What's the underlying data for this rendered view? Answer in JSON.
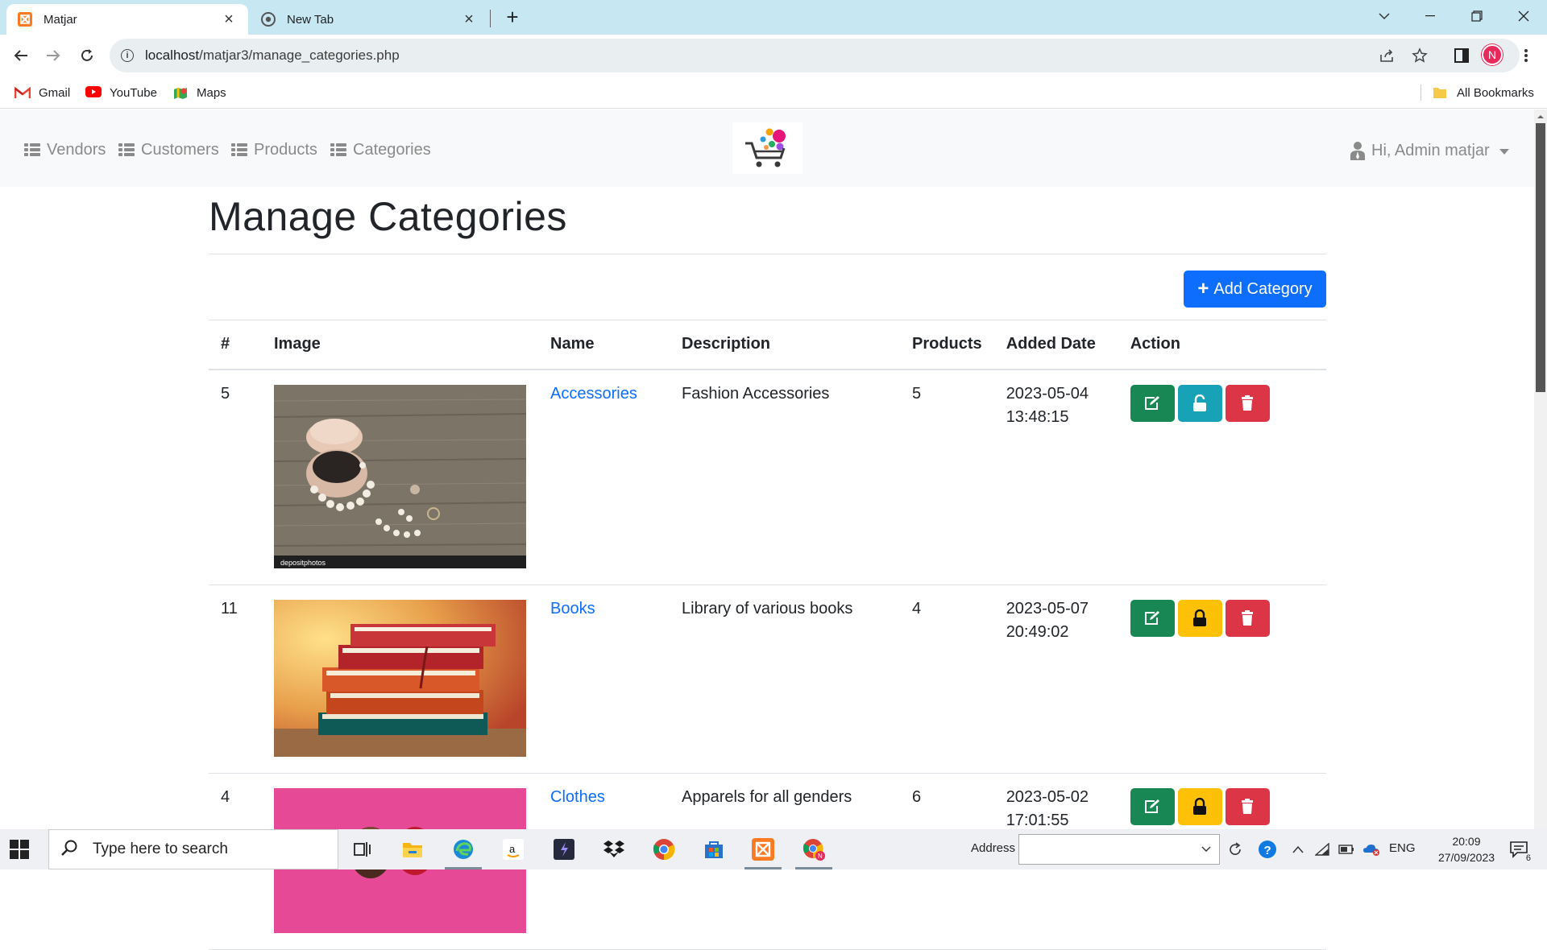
{
  "browser": {
    "tabs": [
      {
        "title": "Matjar",
        "active": true
      },
      {
        "title": "New Tab",
        "active": false
      }
    ],
    "url_host": "localhost",
    "url_path": "/matjar3/manage_categories.php",
    "profile_initial": "N",
    "bookmarks": [
      "Gmail",
      "YouTube",
      "Maps"
    ],
    "all_bookmarks": "All Bookmarks"
  },
  "nav": {
    "items": [
      "Vendors",
      "Customers",
      "Products",
      "Categories"
    ],
    "user": "Hi, Admin matjar"
  },
  "page": {
    "title": "Manage Categories",
    "add_button": "Add Category"
  },
  "table": {
    "headers": [
      "#",
      "Image",
      "Name",
      "Description",
      "Products",
      "Added Date",
      "Action"
    ],
    "rows": [
      {
        "id": "5",
        "name": "Accessories",
        "description": "Fashion Accessories",
        "products": "5",
        "date": "2023-05-04",
        "time": "13:48:15",
        "status": "unlocked"
      },
      {
        "id": "11",
        "name": "Books",
        "description": "Library of various books",
        "products": "4",
        "date": "2023-05-07",
        "time": "20:49:02",
        "status": "locked"
      },
      {
        "id": "4",
        "name": "Clothes",
        "description": "Apparels for all genders",
        "products": "6",
        "date": "2023-05-02",
        "time": "17:01:55",
        "status": "locked"
      }
    ],
    "image_watermark": "depositphotos"
  },
  "colors": {
    "primary": "#0d6efd",
    "success": "#198754",
    "info": "#17a2b8",
    "warning": "#ffc107",
    "danger": "#dc3545"
  },
  "taskbar": {
    "search_placeholder": "Type here to search",
    "address_label": "Address",
    "lang": "ENG",
    "time": "20:09",
    "date": "27/09/2023",
    "notifications": "6"
  }
}
